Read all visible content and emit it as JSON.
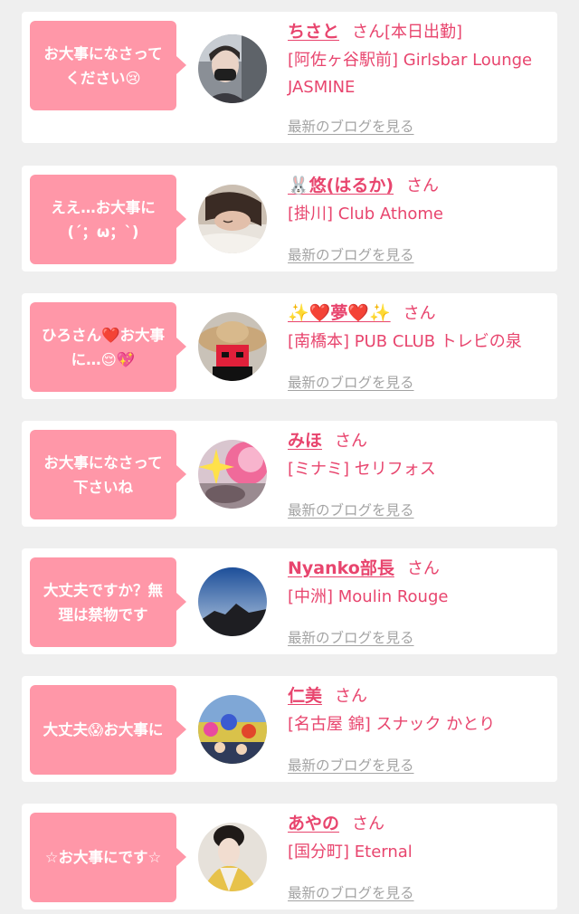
{
  "blog_link_label": "最新のブログを見る",
  "honorific": "さん",
  "colors": {
    "page_bg": "#efefef",
    "card_bg": "#ffffff",
    "bubble": "#ff97a8",
    "accent": "#e8456e",
    "link_gray": "#a3a3a3"
  },
  "cards": [
    {
      "comment": "お大事になさって\nください😢",
      "name": "ちさと",
      "honorific_suffix": "さん[本日出勤]",
      "shop": "[阿佐ヶ谷駅前] Girlsbar Lounge JASMINE",
      "avatar": "woman-with-mask-photo"
    },
    {
      "comment": "ええ…お大事に\n(´；ω；`)",
      "name": "🐰悠(はるか)",
      "honorific_suffix": "さん",
      "shop": "[掛川] Club Athome",
      "avatar": "sleeping-woman-photo"
    },
    {
      "comment": "ひろさん❤️お大事\nに…😌💖",
      "name": "✨❤️夢❤️✨",
      "honorific_suffix": "さん",
      "shop": "[南橋本] PUB CLUB トレビの泉",
      "avatar": "straw-hat-photo"
    },
    {
      "comment": "お大事になさって\n下さいね",
      "name": "みほ",
      "honorific_suffix": "さん",
      "shop": "[ミナミ] セリフォス",
      "avatar": "sparkle-pink-photo"
    },
    {
      "comment": "大丈夫ですか？無\n理は禁物です",
      "name": "Nyanko部長",
      "honorific_suffix": "さん",
      "shop": "[中洲] Moulin Rouge",
      "avatar": "mountain-sky-photo"
    },
    {
      "comment": "大丈夫😱お大事に",
      "name": "仁美",
      "honorific_suffix": "さん",
      "shop": "[名古屋 錦] スナック かとり",
      "avatar": "festival-crowd-photo"
    },
    {
      "comment": "☆お大事にです☆",
      "name": "あやの",
      "honorific_suffix": "さん",
      "shop": "[国分町] Eternal",
      "avatar": "kimono-woman-photo"
    }
  ]
}
